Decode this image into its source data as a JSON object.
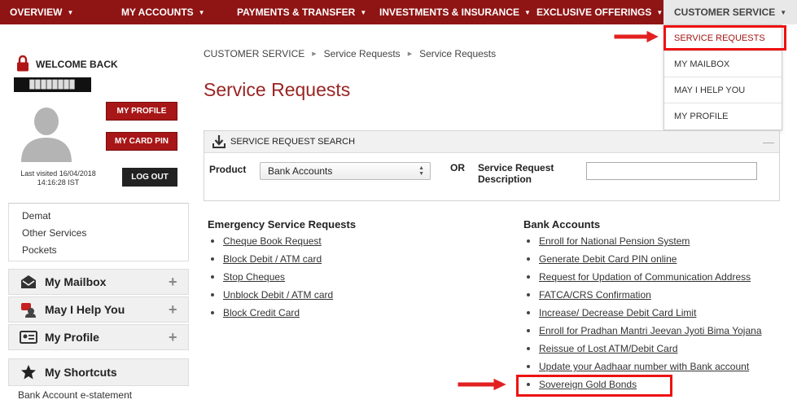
{
  "topnav": {
    "items": [
      {
        "label": "OVERVIEW",
        "caret": "▼"
      },
      {
        "label": "MY ACCOUNTS",
        "caret": "▼"
      },
      {
        "label": "PAYMENTS & TRANSFER",
        "caret": "▼"
      },
      {
        "label": "INVESTMENTS & INSURANCE",
        "caret": "▼"
      },
      {
        "label": "EXCLUSIVE OFFERINGS",
        "caret": "▼"
      },
      {
        "label": "CUSTOMER SERVICE",
        "caret": "▼"
      }
    ]
  },
  "dropdown": {
    "items": [
      {
        "label": "SERVICE REQUESTS"
      },
      {
        "label": "MY MAILBOX"
      },
      {
        "label": "MAY I HELP YOU"
      },
      {
        "label": "MY PROFILE"
      }
    ]
  },
  "profile": {
    "welcome": "WELCOME BACK",
    "username": "████████",
    "my_profile_btn": "MY PROFILE",
    "my_card_pin_btn": "MY CARD PIN",
    "logout_btn": "LOG OUT",
    "last_visited_line1": "Last visited 16/04/2018",
    "last_visited_line2": "14:16:28 IST"
  },
  "sidebar": {
    "list": [
      "Demat",
      "Other Services",
      "Pockets"
    ],
    "accordions": [
      {
        "label": "My Mailbox",
        "icon": "mailbox-icon"
      },
      {
        "label": "May I Help You",
        "icon": "help-icon"
      },
      {
        "label": "My Profile",
        "icon": "profile-card-icon"
      }
    ],
    "shortcuts_label": "My Shortcuts",
    "shortcut_items": [
      "Bank Account e-statement"
    ]
  },
  "breadcrumb": [
    "CUSTOMER SERVICE",
    "Service Requests",
    "Service Requests"
  ],
  "page_title": "Service Requests",
  "search": {
    "title": "SERVICE REQUEST SEARCH",
    "collapse": "—",
    "product_label": "Product",
    "product_value": "Bank Accounts",
    "or_label": "OR",
    "desc_label_1": "Service Request",
    "desc_label_2": "Description",
    "desc_value": ""
  },
  "emergency": {
    "heading": "Emergency Service Requests",
    "links": [
      "Cheque Book Request",
      "Block Debit / ATM card",
      "Stop Cheques",
      "Unblock Debit / ATM card",
      "Block Credit Card"
    ]
  },
  "bank_accounts": {
    "heading": "Bank Accounts",
    "links": [
      "Enroll for National Pension System",
      "Generate Debit Card PIN online",
      "Request for Updation of Communication Address",
      "FATCA/CRS Confirmation",
      "Increase/ Decrease Debit Card Limit",
      "Enroll for Pradhan Mantri Jeevan Jyoti Bima Yojana",
      "Reissue of Lost ATM/Debit Card",
      "Update your Aadhaar number with Bank account",
      "Sovereign Gold Bonds"
    ]
  },
  "colors": {
    "brand": "#8f1414",
    "title": "#9a2424",
    "highlight": "#e11"
  }
}
